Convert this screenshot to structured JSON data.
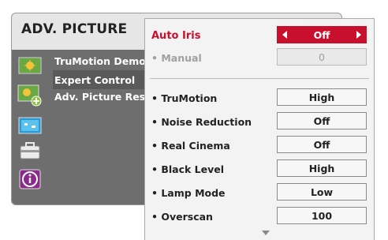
{
  "back_menu": {
    "title": "ADV. PICTURE",
    "icons": [
      "picture-icon",
      "picture-settings-icon",
      "screen-icon",
      "toolbox-icon",
      "info-icon"
    ],
    "items": [
      {
        "label": "TruMotion Demo"
      },
      {
        "label": "Expert Control"
      },
      {
        "label": "Adv. Picture Reset"
      }
    ]
  },
  "settings": {
    "auto_iris": {
      "label": "Auto Iris",
      "value": "Off"
    },
    "manual": {
      "label": "• Manual",
      "value": "0"
    },
    "rows": [
      {
        "label": "• TruMotion",
        "value": "High"
      },
      {
        "label": "• Noise Reduction",
        "value": "Off"
      },
      {
        "label": "• Real Cinema",
        "value": "Off"
      },
      {
        "label": "• Black Level",
        "value": "High"
      },
      {
        "label": "• Lamp Mode",
        "value": "Low"
      },
      {
        "label": "• Overscan",
        "value": "100"
      }
    ]
  },
  "colors": {
    "accent": "#c8102e",
    "menu_body": "#6e6e6e",
    "panel_bg": "#f3f3f3"
  }
}
